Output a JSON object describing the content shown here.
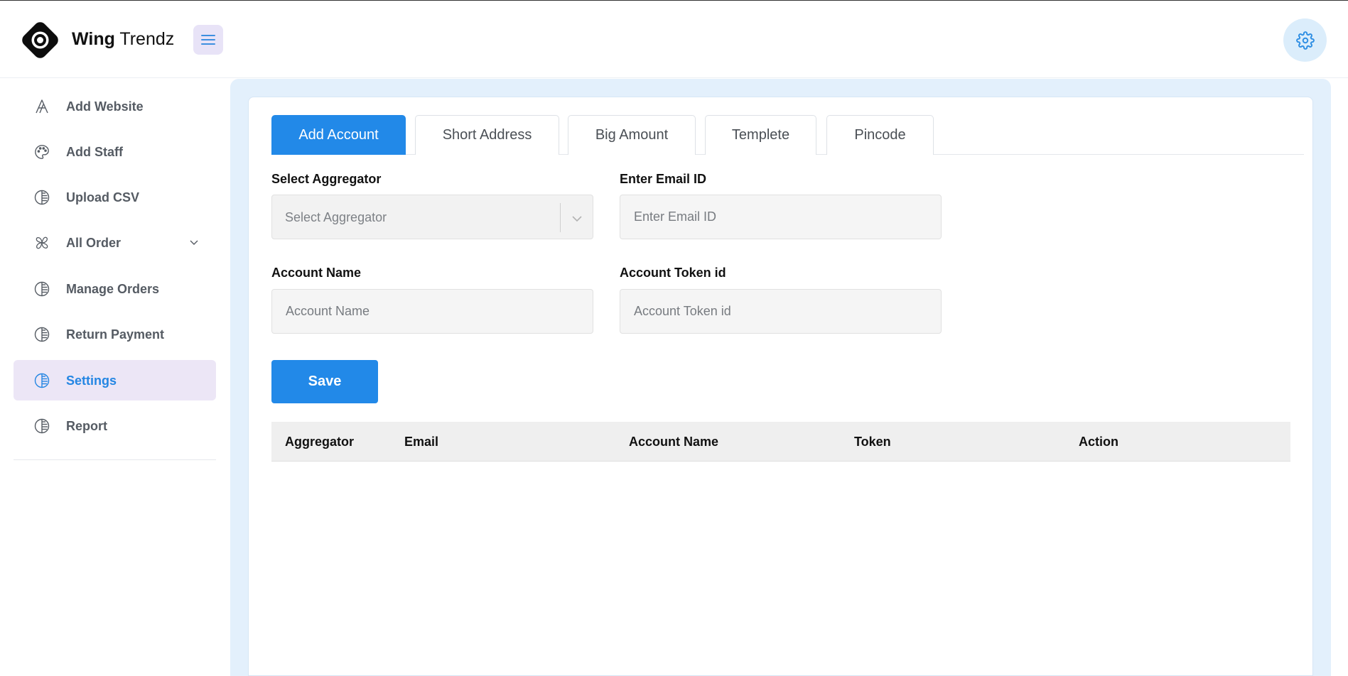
{
  "brand": {
    "name_bold": "Wing",
    "name_light": "Trendz"
  },
  "sidebar": {
    "items": [
      {
        "label": "Add Website",
        "icon": "font-icon"
      },
      {
        "label": "Add Staff",
        "icon": "palette-icon"
      },
      {
        "label": "Upload CSV",
        "icon": "circle-half-icon"
      },
      {
        "label": "All Order",
        "icon": "pinwheel-icon"
      },
      {
        "label": "Manage Orders",
        "icon": "circle-half-icon"
      },
      {
        "label": "Return Payment",
        "icon": "circle-half-icon"
      },
      {
        "label": "Settings",
        "icon": "circle-half-icon",
        "active": true
      },
      {
        "label": "Report",
        "icon": "circle-half-icon"
      }
    ]
  },
  "tabs": [
    {
      "label": "Add Account",
      "active": true
    },
    {
      "label": "Short Address"
    },
    {
      "label": "Big Amount"
    },
    {
      "label": "Templete"
    },
    {
      "label": "Pincode"
    }
  ],
  "form": {
    "aggregator_label": "Select Aggregator",
    "aggregator_placeholder": "Select Aggregator",
    "email_label": "Enter Email ID",
    "email_placeholder": "Enter Email ID",
    "account_name_label": "Account Name",
    "account_name_placeholder": "Account Name",
    "token_label": "Account Token id",
    "token_placeholder": "Account Token id",
    "save_label": "Save"
  },
  "table": {
    "columns": [
      "Aggregator",
      "Email",
      "Account Name",
      "Token",
      "Action"
    ],
    "rows": []
  },
  "colors": {
    "accent": "#2289e8",
    "active_bg": "#ece6f6",
    "main_bg": "#e3f0fc"
  }
}
